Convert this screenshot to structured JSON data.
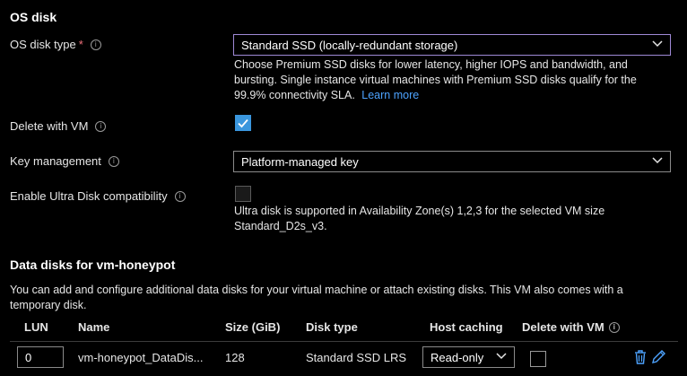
{
  "os_disk": {
    "heading": "OS disk",
    "disk_type_label": "OS disk type",
    "required_mark": "*",
    "disk_type_value": "Standard SSD (locally-redundant storage)",
    "disk_type_help": "Choose Premium SSD disks for lower latency, higher IOPS and bandwidth, and bursting. Single instance virtual machines with Premium SSD disks qualify for the 99.9% connectivity SLA.",
    "learn_more": "Learn more",
    "delete_with_vm_label": "Delete with VM",
    "delete_with_vm_checked": true,
    "key_management_label": "Key management",
    "key_management_value": "Platform-managed key",
    "ultra_disk_label": "Enable Ultra Disk compatibility",
    "ultra_disk_checked": false,
    "ultra_disk_help": "Ultra disk is supported in Availability Zone(s) 1,2,3 for the selected VM size Standard_D2s_v3."
  },
  "data_disks": {
    "heading": "Data disks for vm-honeypot",
    "description": "You can add and configure additional data disks for your virtual machine or attach existing disks. This VM also comes with a temporary disk.",
    "columns": [
      "LUN",
      "Name",
      "Size (GiB)",
      "Disk type",
      "Host caching",
      "Delete with VM"
    ],
    "rows": [
      {
        "lun": "0",
        "name": "vm-honeypot_DataDis...",
        "size": "128",
        "disk_type": "Standard SSD LRS",
        "host_caching": "Read-only",
        "delete_with_vm": false
      }
    ]
  },
  "icons": {
    "info": "info-icon",
    "chevron": "chevron-down-icon",
    "delete": "trash-icon",
    "edit": "pencil-icon"
  },
  "colors": {
    "background": "#000000",
    "link": "#4da3ff",
    "checkbox_checked": "#3a96dd",
    "focus_border": "#9f89d6",
    "required": "#f1707b"
  }
}
